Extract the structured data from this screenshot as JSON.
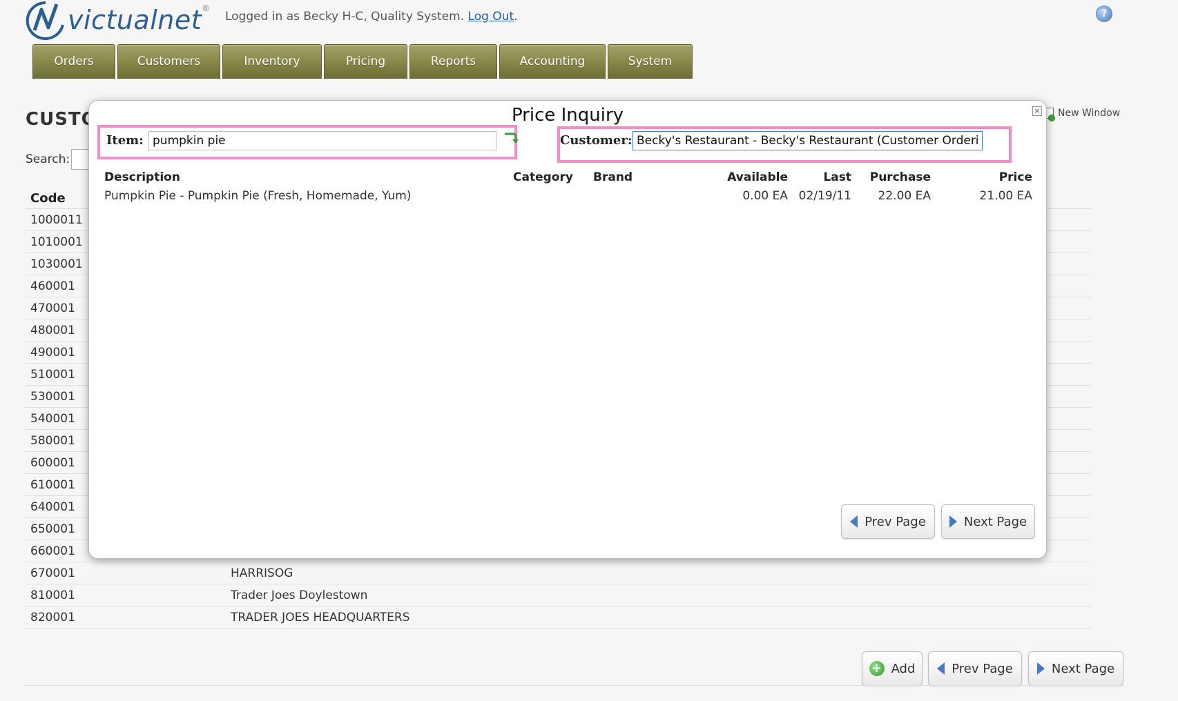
{
  "header": {
    "logo_text": "victualnet",
    "logo_reg": "®",
    "login_text": "Logged in as Becky H-C, Quality System.",
    "logout_label": "Log Out",
    "logout_suffix": ".",
    "help_label": "?"
  },
  "nav": {
    "tabs": [
      "Orders",
      "Customers",
      "Inventory",
      "Pricing",
      "Reports",
      "Accounting",
      "System"
    ]
  },
  "page": {
    "title": "CUSTO",
    "search_label": "Search:",
    "new_window_label": "New Window",
    "table": {
      "code_header": "Code",
      "rows": [
        {
          "code": "1000011",
          "name": ""
        },
        {
          "code": "1010001",
          "name": ""
        },
        {
          "code": "1030001",
          "name": ""
        },
        {
          "code": "460001",
          "name": ""
        },
        {
          "code": "470001",
          "name": ""
        },
        {
          "code": "480001",
          "name": ""
        },
        {
          "code": "490001",
          "name": ""
        },
        {
          "code": "510001",
          "name": ""
        },
        {
          "code": "530001",
          "name": ""
        },
        {
          "code": "540001",
          "name": ""
        },
        {
          "code": "580001",
          "name": ""
        },
        {
          "code": "600001",
          "name": ""
        },
        {
          "code": "610001",
          "name": ""
        },
        {
          "code": "640001",
          "name": ""
        },
        {
          "code": "650001",
          "name": ""
        },
        {
          "code": "660001",
          "name": ""
        },
        {
          "code": "670001",
          "name": "HARRISOG"
        },
        {
          "code": "810001",
          "name": "Trader Joes Doylestown"
        },
        {
          "code": "820001",
          "name": "TRADER JOES HEADQUARTERS"
        }
      ]
    },
    "buttons": {
      "add": "Add",
      "prev": "Prev Page",
      "next": "Next Page"
    }
  },
  "modal": {
    "title": "Price Inquiry",
    "close_label": "×",
    "item_label": "Item:",
    "item_value": "pumpkin pie",
    "customer_label": "Customer:",
    "customer_value": "Becky's Restaurant - Becky's Restaurant (Customer Ordering",
    "columns": {
      "description": "Description",
      "category": "Category",
      "brand": "Brand",
      "available": "Available",
      "last": "Last",
      "purchase": "Purchase",
      "price": "Price"
    },
    "results": [
      {
        "description": "Pumpkin Pie - Pumpkin Pie (Fresh, Homemade, Yum)",
        "category": "",
        "brand": "",
        "available": "0.00 EA",
        "last": "02/19/11",
        "purchase": "22.00 EA",
        "price": "21.00 EA"
      }
    ],
    "prev_label": "Prev Page",
    "next_label": "Next Page"
  },
  "colors": {
    "nav_tab": "#8a8b4d",
    "highlight": "#f48cc8",
    "link": "#1f5aa6",
    "arrow": "#4a79c4"
  }
}
